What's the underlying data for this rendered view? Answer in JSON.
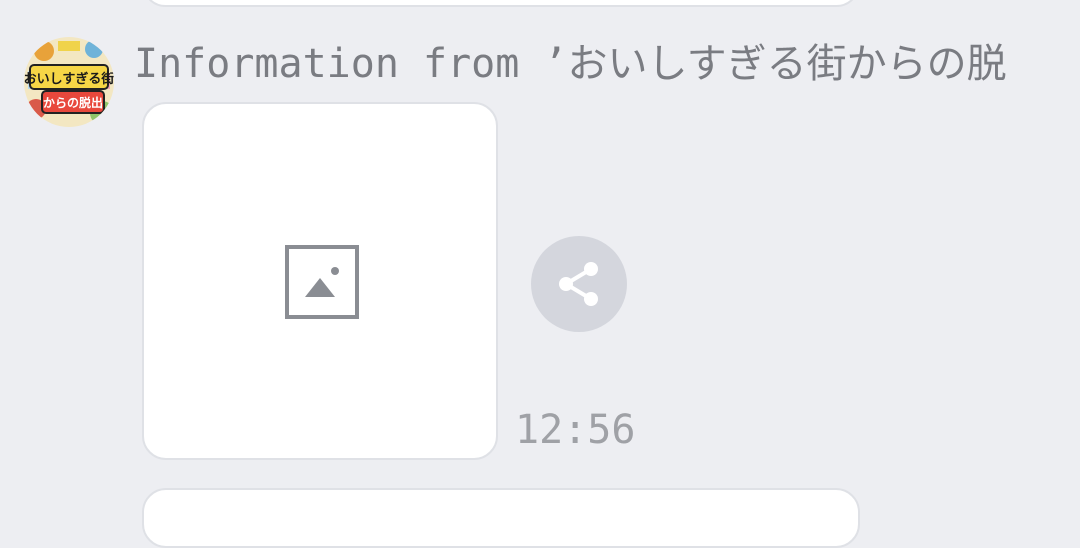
{
  "message": {
    "sender_name": "Information from ’おいしすぎる街からの脱",
    "timestamp": "12:56",
    "avatar_text_top": "おいしすぎる街",
    "avatar_text_bottom": "からの脱出",
    "image_placeholder_icon": "image-placeholder-icon",
    "share_icon": "share-icon"
  },
  "colors": {
    "background": "#edeef2",
    "bubble": "#ffffff",
    "bubble_border": "#dfe1e6",
    "share_button_bg": "#d4d6dd",
    "icon_gray": "#8a8d93",
    "name_text": "#7a7c82",
    "timestamp_text": "#9fa1a6"
  }
}
